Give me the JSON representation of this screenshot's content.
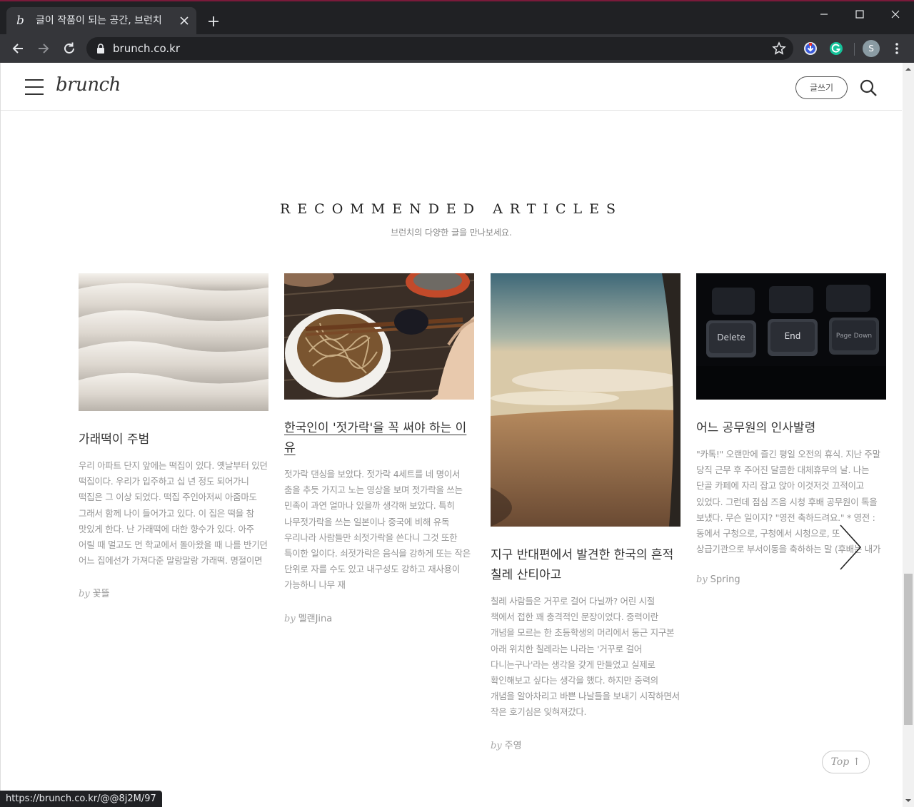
{
  "browser": {
    "tab_title": "글이 작품이 되는 공간, 브런치",
    "url": "brunch.co.kr",
    "status_url": "https://brunch.co.kr/@@8j2M/97",
    "profile_initial": "S"
  },
  "header": {
    "logo": "brunch",
    "write_label": "글쓰기"
  },
  "section": {
    "title": "RECOMMENDED ARTICLES",
    "subtitle": "브런치의 다양한 글을 만나보세요."
  },
  "articles": [
    {
      "title": "가래떡이 주범",
      "excerpt": "우리 아파트 단지 앞에는 떡집이 있다. 옛날부터 있던 떡집이다. 우리가 입주하고 십 년 정도 되어가니 떡집은 그 이상 되었다. 떡집 주인아저씨 아줌마도 그래서 함께 나이 들어가고 있다. 이 집은 떡을 참 맛있게 한다. 난 가래떡에 대한 향수가 있다. 아주 어릴 때 멀고도 먼 학교에서 돌아왔을 때 나를 반기던 어느 집에선가 가져다준 말랑말랑 가래떡. 명절이면",
      "by": "by",
      "author": "꽃뜰"
    },
    {
      "title": "한국인이 '젓가락'을 꼭 써야 하는 이유",
      "excerpt": "젓가락 댄싱을 보았다. 젓가락 4세트를 네 명이서 춤을 추듯 가지고 노는 영상을 보며 젓가락을 쓰는 민족이 과연 얼마나 있을까 생각해 보았다. 특히 나무젓가락을 쓰는 일본이나 중국에 비해 유독 우리나라 사람들만 쇠젓가락을 쓴다니 그것 또한 특이한 일이다. 쇠젓가락은 음식을 강하게 또는 작은 단위로 자를 수도 있고 내구성도 강하고 재사용이 가능하니 나무 재",
      "by": "by",
      "author": "멜랜Jina"
    },
    {
      "title": "지구 반대편에서 발견한 한국의 흔적 칠레 산티아고",
      "excerpt": "칠레 사람들은 거꾸로 걸어 다닐까? 어린 시절 책에서 접한 꽤 충격적인 문장이었다. 중력이란 개념을 모르는 한 초등학생의 머리에서 둥근 지구본 아래 위치한 칠레라는 나라는 '거꾸로 걸어 다니는구나'라는 생각을 갖게 만들었고 실제로 확인해보고 싶다는 생각을 했다. 하지만 중력의 개념을 알아차리고 바쁜 나날들을 보내기 시작하면서 작은 호기심은 잊혀져갔다.",
      "by": "by",
      "author": "주영"
    },
    {
      "title": "어느 공무원의 인사발령",
      "excerpt": "\"카톡!\" 오랜만에 즐긴 평일 오전의 휴식. 지난 주말 당직 근무 후 주어진 달콤한 대체휴무의 날. 나는 단골 카페에 자리 잡고 앉아 이것저것 끄적이고 있었다. 그런데 점심 즈음 시청 후배 공무원이 톡을 보냈다. 무슨 일이지? \"영전 축하드려요.\" * 영전 : 동에서 구청으로, 구청에서 시청으로, 또 상급기관으로 부서이동을 축하하는 말 (후배는 내가",
      "by": "by",
      "author": "Spring"
    }
  ],
  "keyboard_keys": [
    "Delete",
    "End",
    "Page Down"
  ],
  "top_button": "Top ↑",
  "icons": {
    "favicon": "brunch-b-icon",
    "menu": "hamburger-icon",
    "search": "search-icon",
    "next": "chevron-right-icon"
  }
}
